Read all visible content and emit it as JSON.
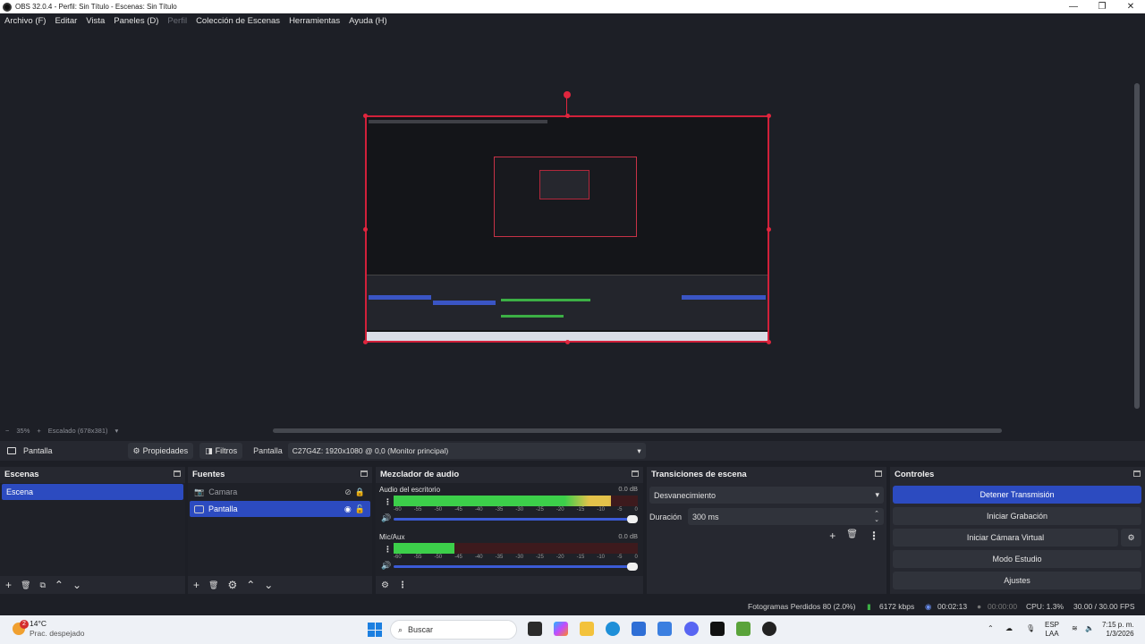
{
  "window": {
    "title": "OBS 32.0.4 - Perfil: Sin Título - Escenas: Sin Título",
    "controls": [
      "—",
      "❐",
      "✕"
    ]
  },
  "menu": {
    "items": [
      "Archivo (F)",
      "Editar",
      "Vista",
      "Paneles (D)",
      "Perfil",
      "Colección de Escenas",
      "Herramientas",
      "Ayuda (H)"
    ],
    "disabled": "Perfil"
  },
  "zoom": {
    "minus": "−",
    "level": "35%",
    "plus": "+",
    "scaled": "Escalado (678x381)",
    "dropdown": "▾"
  },
  "source_toolbar": {
    "source_name": "Pantalla",
    "properties": "Propiedades",
    "filters": "Filtros",
    "display_label": "Pantalla",
    "display_value": "C27G4Z: 1920x1080 @ 0,0 (Monitor principal)"
  },
  "scenes": {
    "title": "Escenas",
    "items": [
      {
        "label": "Escena",
        "selected": true
      }
    ],
    "footer": [
      "+",
      "🗑",
      "⧉",
      "⌃",
      "⌄"
    ]
  },
  "sources": {
    "title": "Fuentes",
    "items": [
      {
        "label": "Camara",
        "visible": false,
        "locked": true,
        "selected": false,
        "icon": "camera-icon"
      },
      {
        "label": "Pantalla",
        "visible": true,
        "locked": true,
        "selected": true,
        "icon": "monitor-icon"
      }
    ],
    "footer": [
      "+",
      "🗑",
      "⚙",
      "⌃",
      "⌄"
    ]
  },
  "mixer": {
    "title": "Mezclador de audio",
    "channels": [
      {
        "name": "Audio del escritorio",
        "db": "0.0 dB",
        "level": 0.89
      },
      {
        "name": "Mic/Aux",
        "db": "0.0 dB",
        "level": 0.25
      }
    ],
    "ticks": [
      "-60",
      "-55",
      "-50",
      "-45",
      "-40",
      "-35",
      "-30",
      "-25",
      "-20",
      "-15",
      "-10",
      "-5",
      "0"
    ]
  },
  "transitions": {
    "title": "Transiciones de escena",
    "selected": "Desvanecimiento",
    "duration_label": "Duración",
    "duration_value": "300 ms"
  },
  "controls": {
    "title": "Controles",
    "buttons": [
      "Detener Transmisión",
      "Iniciar Grabación",
      "Iniciar Cámara Virtual",
      "Modo Estudio",
      "Ajustes"
    ]
  },
  "status": {
    "dropped": "Fotogramas Perdidos 80 (2.0%)",
    "bitrate": "6172 kbps",
    "stream_time": "00:02:13",
    "rec_time": "00:00:00",
    "cpu": "CPU: 1.3%",
    "fps": "30.00 / 30.00 FPS"
  },
  "taskbar": {
    "temp": "14°C",
    "weather": "Prac. despejado",
    "weather_badge": "2",
    "search": "Buscar",
    "lang1": "ESP",
    "lang2": "LAA",
    "time": "7:15 p. m.",
    "date": "1/3/2026"
  }
}
